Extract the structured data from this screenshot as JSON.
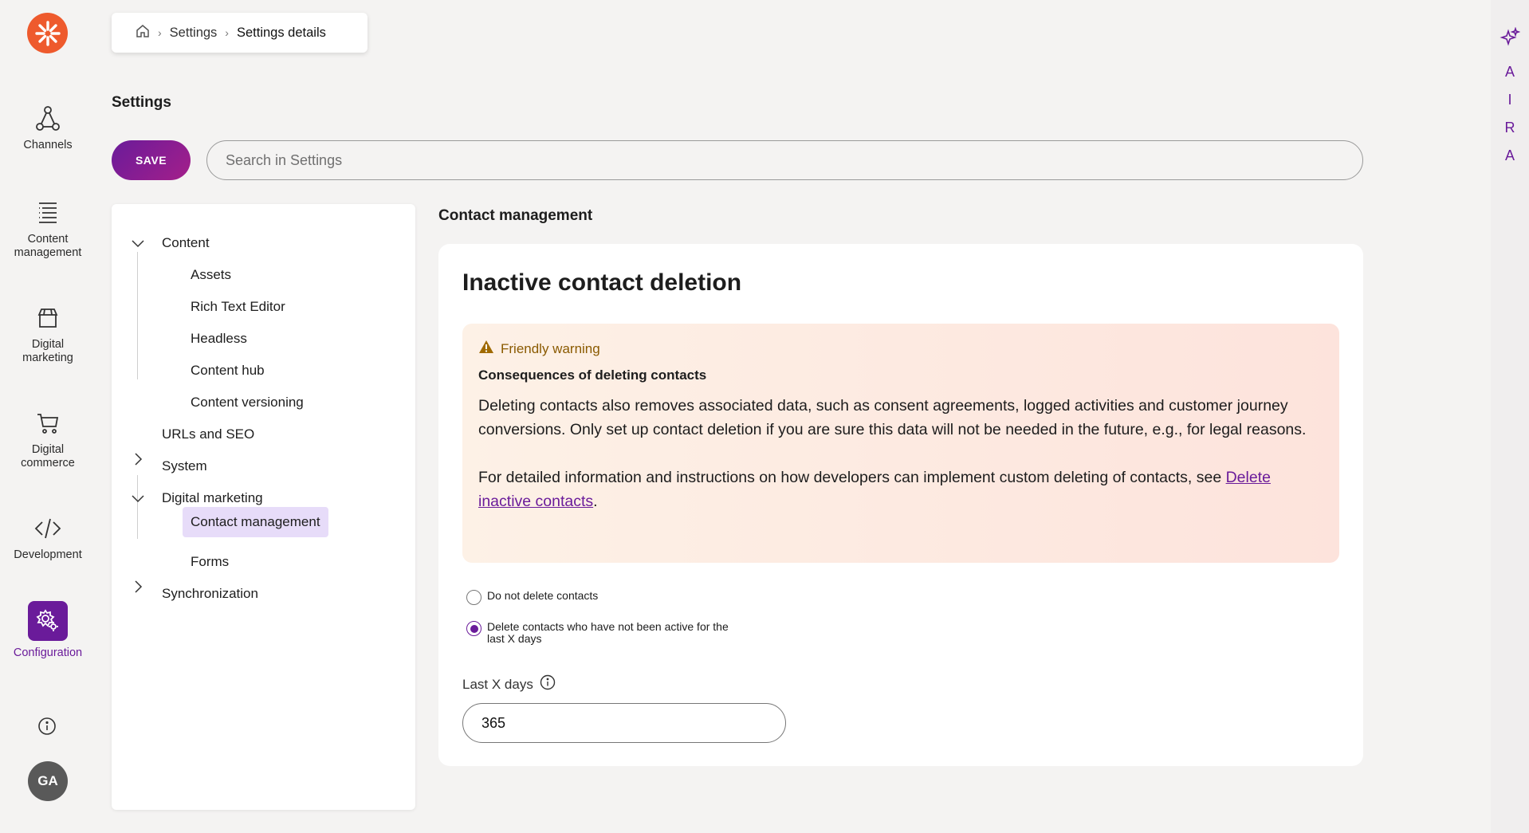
{
  "app": {
    "accent_color": "#6a1b9a",
    "logo_color": "#ee5a2d"
  },
  "rail": {
    "items": [
      {
        "label": "Channels",
        "icon": "channels-icon"
      },
      {
        "label": "Content management",
        "icon": "content-management-icon"
      },
      {
        "label": "Digital marketing",
        "icon": "digital-marketing-icon"
      },
      {
        "label": "Digital commerce",
        "icon": "cart-icon"
      },
      {
        "label": "Development",
        "icon": "code-icon"
      },
      {
        "label": "Configuration",
        "icon": "gear-icon",
        "active": true
      }
    ],
    "avatar_initials": "GA"
  },
  "breadcrumb": {
    "items": [
      "Settings",
      "Settings details"
    ]
  },
  "page": {
    "title": "Settings",
    "save_label": "SAVE",
    "search_placeholder": "Search in Settings"
  },
  "tree": {
    "nodes": [
      {
        "label": "Content",
        "expanded": true
      },
      {
        "label": "Assets"
      },
      {
        "label": "Rich Text Editor"
      },
      {
        "label": "Headless"
      },
      {
        "label": "Content hub"
      },
      {
        "label": "Content versioning"
      },
      {
        "label": "URLs and SEO"
      },
      {
        "label": "System",
        "expanded": false
      },
      {
        "label": "Digital marketing",
        "expanded": true
      },
      {
        "label": "Contact management",
        "selected": true
      },
      {
        "label": "Forms"
      },
      {
        "label": "Synchronization",
        "expanded": false
      }
    ]
  },
  "content": {
    "section_title": "Contact management",
    "card_title": "Inactive contact deletion",
    "warning": {
      "heading": "Friendly warning",
      "subheading": "Consequences of deleting contacts",
      "paragraph1": "Deleting contacts also removes associated data, such as consent agreements, logged activities and customer journey conversions. Only set up contact deletion if you are sure this data will not be needed in the future, e.g., for legal reasons.",
      "paragraph2_prefix": "For detailed information and instructions on how developers can implement custom deleting of contacts, see ",
      "paragraph2_link": "Delete inactive contacts",
      "paragraph2_suffix": "."
    },
    "options": [
      {
        "label": "Do not delete contacts",
        "selected": false
      },
      {
        "label": "Delete contacts who have not been active for the last X days",
        "selected": true
      }
    ],
    "days_label": "Last X days",
    "days_value": "365"
  },
  "aira": {
    "letters": [
      "A",
      "I",
      "R",
      "A"
    ]
  }
}
